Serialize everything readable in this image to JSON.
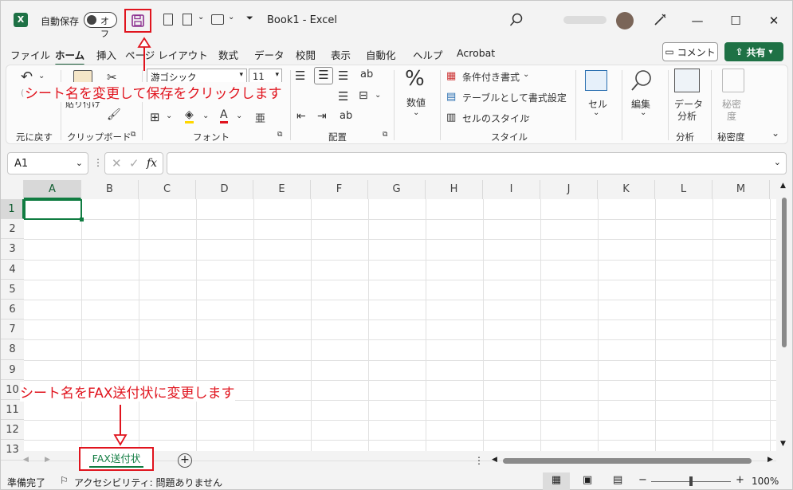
{
  "titlebar": {
    "autosave_label": "自動保存",
    "toggle_state": "オフ",
    "doc_title": "Book1  -  Excel"
  },
  "tabs": [
    "ファイル",
    "ホーム",
    "挿入",
    "ページ レイアウト",
    "数式",
    "データ",
    "校閲",
    "表示",
    "自動化",
    "ヘルプ",
    "Acrobat"
  ],
  "active_tab": "ホーム",
  "comment_btn": "コメント",
  "share_btn": "共有",
  "ribbon": {
    "undo_group": "元に戻す",
    "clipboard_group": "クリップボード",
    "paste_label": "貼り付け",
    "font_name": "游ゴシック",
    "font_size": "11",
    "font_group": "フォント",
    "align_group": "配置",
    "number_label": "数値",
    "cond_format": "条件付き書式",
    "table_format": "テーブルとして書式設定",
    "cell_styles": "セルのスタイル",
    "style_group": "スタイル",
    "cells_label": "セル",
    "edit_label": "編集",
    "analysis_btn_l1": "データ",
    "analysis_btn_l2": "分析",
    "analysis_group": "分析",
    "sensitivity_btn_l1": "秘密",
    "sensitivity_btn_l2": "度",
    "sensitivity_group": "秘密度"
  },
  "formula": {
    "namebox": "A1",
    "fx": "fx",
    "value": ""
  },
  "columns": [
    "A",
    "B",
    "C",
    "D",
    "E",
    "F",
    "G",
    "H",
    "I",
    "J",
    "K",
    "L",
    "M"
  ],
  "rows": [
    "1",
    "2",
    "3",
    "4",
    "5",
    "6",
    "7",
    "8",
    "9",
    "10",
    "11",
    "12",
    "13"
  ],
  "sheet_tab": "FAX送付状",
  "status": {
    "ready": "準備完了",
    "accessibility": "アクセシビリティ: 問題ありません",
    "zoom": "100%"
  },
  "annotations": {
    "top": "シート名を変更して保存をクリックします",
    "bottom": "シート名をFAX送付状に変更します"
  },
  "colors": {
    "excel_green": "#1e7145",
    "annotation_red": "#e0141e",
    "active_tab_line": "#185c37",
    "save_icon": "#8b2f8f"
  }
}
